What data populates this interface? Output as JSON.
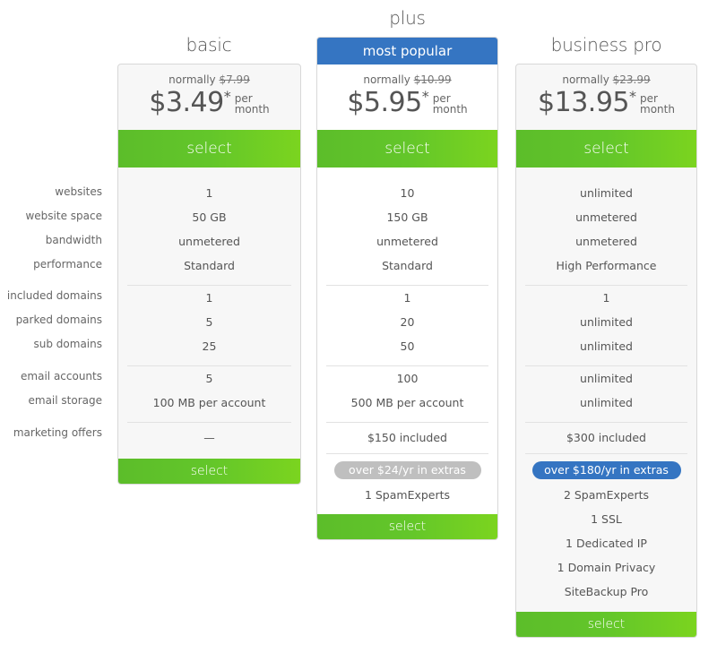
{
  "feature_labels": [
    "websites",
    "website space",
    "bandwidth",
    "performance",
    "included domains",
    "parked domains",
    "sub domains",
    "email accounts",
    "email storage",
    "marketing offers"
  ],
  "plans": [
    {
      "name": "basic",
      "normally_label": "normally",
      "old_price": "$7.99",
      "price": "$3.49",
      "asterisk": "*",
      "per": "per",
      "month": "month",
      "select_label": "select",
      "values": {
        "websites": "1",
        "website_space": "50 GB",
        "bandwidth": "unmetered",
        "performance": "Standard",
        "included_domains": "1",
        "parked_domains": "5",
        "sub_domains": "25",
        "email_accounts": "5",
        "email_storage": "100 MB per account",
        "marketing_offers": "—"
      }
    },
    {
      "name": "plus",
      "badge": "most popular",
      "normally_label": "normally",
      "old_price": "$10.99",
      "price": "$5.95",
      "asterisk": "*",
      "per": "per",
      "month": "month",
      "select_label": "select",
      "values": {
        "websites": "10",
        "website_space": "150 GB",
        "bandwidth": "unmetered",
        "performance": "Standard",
        "included_domains": "1",
        "parked_domains": "20",
        "sub_domains": "50",
        "email_accounts": "100",
        "email_storage": "500 MB per account",
        "marketing_offers": "$150 included"
      },
      "extras_pill": "over $24/yr in extras",
      "extras": [
        "1 SpamExperts"
      ]
    },
    {
      "name": "business pro",
      "normally_label": "normally",
      "old_price": "$23.99",
      "price": "$13.95",
      "asterisk": "*",
      "per": "per",
      "month": "month",
      "select_label": "select",
      "values": {
        "websites": "unlimited",
        "website_space": "unmetered",
        "bandwidth": "unmetered",
        "performance": "High Performance",
        "included_domains": "1",
        "parked_domains": "unlimited",
        "sub_domains": "unlimited",
        "email_accounts": "unlimited",
        "email_storage": "unlimited",
        "marketing_offers": "$300 included"
      },
      "extras_pill": "over $180/yr in extras",
      "extras": [
        "2 SpamExperts",
        "1 SSL",
        "1 Dedicated IP",
        "1 Domain Privacy",
        "SiteBackup Pro"
      ]
    }
  ],
  "colors": {
    "select_green": "#63c62a",
    "badge_blue": "#3575c2",
    "pill_gray": "#bfbfbf"
  }
}
